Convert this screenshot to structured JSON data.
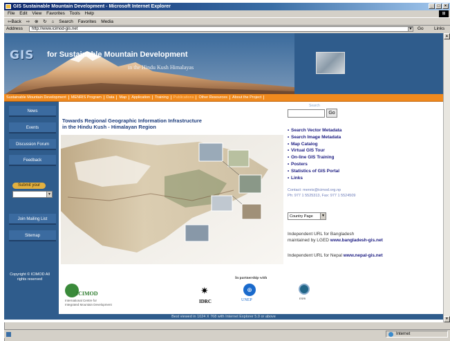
{
  "window": {
    "title": "GIS Sustainable Mountain Development - Microsoft Internet Explorer",
    "controls": [
      "_",
      "□",
      "×"
    ]
  },
  "menubar": {
    "items": [
      "File",
      "Edit",
      "View",
      "Favorites",
      "Tools",
      "Help"
    ]
  },
  "toolbar": {
    "back": "⇦Back",
    "forward": "⇨",
    "stop": "⊗",
    "refresh": "↻",
    "home": "⌂",
    "search": "Search",
    "favorites": "Favorites",
    "media": "Media"
  },
  "address": {
    "label": "Address",
    "url": "http://www.icimod-gis.net",
    "go_label": "Go",
    "links_label": "Links"
  },
  "banner": {
    "logo": "GIS",
    "title": "for Sustainable Mountain Development",
    "subtitle": "in the Hindu Kush Himalayas"
  },
  "nav": {
    "items": [
      {
        "label": "Sustainable Mountain Development",
        "dim": false
      },
      {
        "label": "MENRIS Program",
        "dim": false
      },
      {
        "label": "Data",
        "dim": false
      },
      {
        "label": "Map",
        "dim": false
      },
      {
        "label": "Application",
        "dim": false
      },
      {
        "label": "Training",
        "dim": false
      },
      {
        "label": "Publications",
        "dim": true
      },
      {
        "label": "Other Resources",
        "dim": false
      },
      {
        "label": "About the Project",
        "dim": false
      }
    ]
  },
  "sidebar": {
    "buttons": [
      "News",
      "Events",
      "Discussion Forum",
      "Feedback",
      "Join Mailing List",
      "Sitemap"
    ],
    "submit_label": "Submit your",
    "copyright": "Copyright © ICIMOD All rights reserved"
  },
  "main": {
    "headline_line1": "Towards Regional Geographic Information Infrastructure",
    "headline_line2": "in the Hindu Kush - Himalayan Region"
  },
  "right": {
    "search_label": "Search",
    "search_button": "Go",
    "links": [
      "Search Vector Metadata",
      "Search Image Metadata",
      "Map Catalog",
      "Virtual GIS Tour",
      "On-line GIS Training",
      "Posters",
      "Statistics of GIS Portal",
      "Links"
    ],
    "contact_line1": "Contact: menris@icimod.org.np",
    "contact_line2": "Ph: 977 1 5525313, Fax: 977 1 5524509",
    "country_select": "Country Page",
    "bd_line1": "Independent URL for Bangladesh",
    "bd_line2_prefix": "maintained by LGED ",
    "bd_link": "www.bangladesh-gis.net",
    "np_prefix": "Independent URL for Nepal ",
    "np_link": "www.nepal-gis.net"
  },
  "partners": {
    "label": "In partnership with",
    "icimod": "ICIMOD",
    "icimod_sub1": "International Centre for",
    "icimod_sub2": "Integrated Mountain Development",
    "idrc": "IDRC",
    "unep": "UNEP",
    "esri": "ESRI"
  },
  "footer": "Best viewed in 1024 X 768 with Internet Explorer 5.0 or above",
  "status": {
    "zone": "Internet"
  },
  "colors": {
    "banner": "#2f5c8c",
    "nav": "#f08a1e",
    "link": "#1a1a80"
  }
}
